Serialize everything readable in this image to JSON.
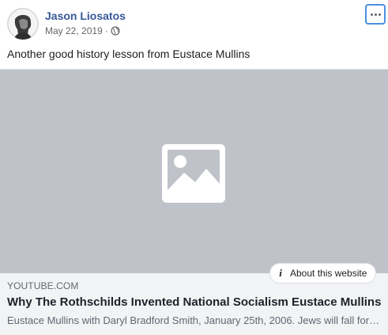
{
  "post": {
    "author": "Jason Liosatos",
    "date": "May 22, 2019",
    "separator": "·",
    "audience_icon": "globe-icon",
    "more_icon": "more-options-icon",
    "text": "Another good history lesson from Eustace Mullins"
  },
  "link_preview": {
    "image_icon": "image-placeholder-icon",
    "about_label": "About this website",
    "about_icon": "info-icon",
    "domain": "YOUTUBE.COM",
    "title": "Why The Rothschilds Invented National Socialism Eustace Mullins",
    "description": "Eustace Mullins with Daryl Bradford Smith, January 25th, 2006. Jews will fall for anything"
  },
  "colors": {
    "author_link": "#385898",
    "focus_outline": "#4a90e2",
    "image_placeholder_bg": "#c0c2ca",
    "link_info_bg": "#f2f3f5",
    "secondary_text": "#606770"
  }
}
